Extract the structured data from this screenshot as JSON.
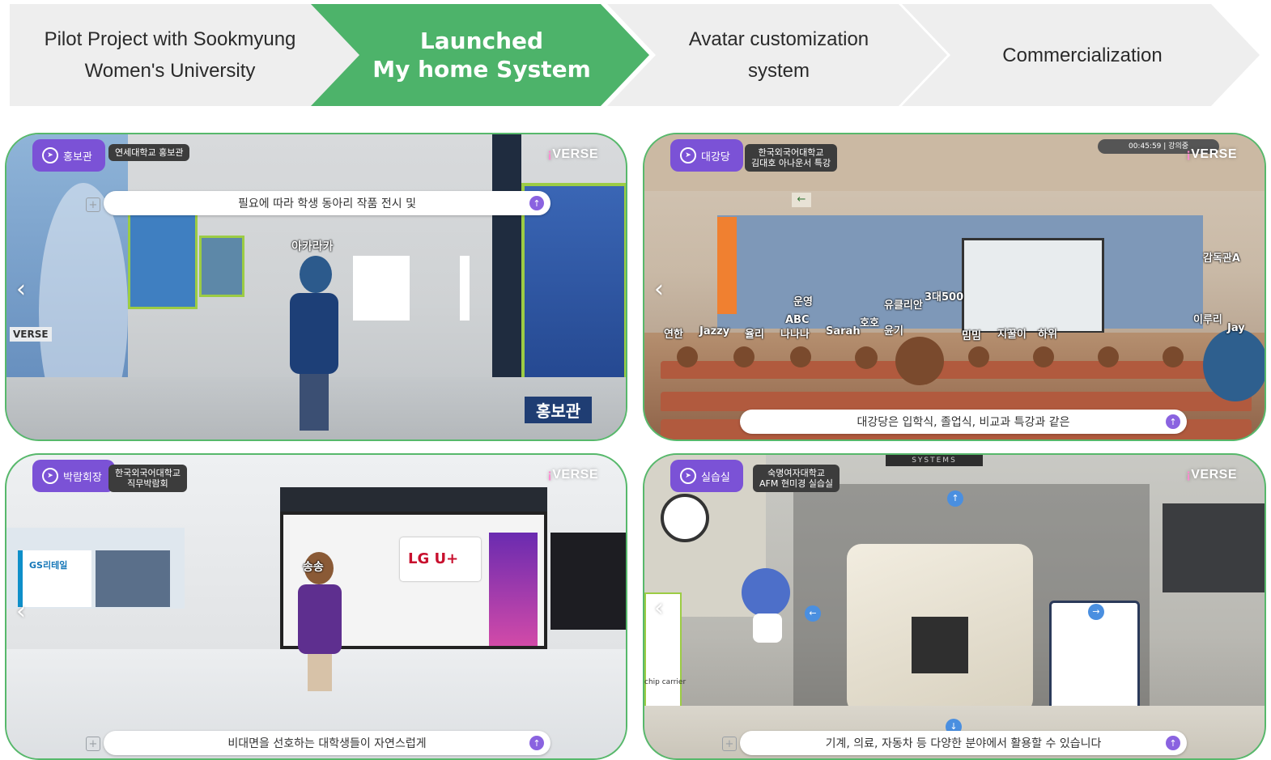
{
  "steps": [
    {
      "line1": "Pilot Project with Sookmyung",
      "line2": "Women's University",
      "active": false
    },
    {
      "line1": "Launched",
      "line2": "My home System",
      "active": true
    },
    {
      "line1": "Avatar customization",
      "line2": "system",
      "active": false
    },
    {
      "line1": "Commercialization",
      "line2": "",
      "active": false
    }
  ],
  "colors": {
    "accent_green": "#4db36a",
    "inactive_gray": "#eeeeee",
    "pill_purple": "#7b52d6",
    "panel_border": "#57b86b"
  },
  "brand": "VERSE",
  "panels": {
    "p1": {
      "location": "홍보관",
      "label": "연세대학교 홍보관",
      "chat": "필요에 따라 학생 동아리 작품 전시 및",
      "avatar_name": "아카라카",
      "sign": "홍보관",
      "wall_logo": "VERSE"
    },
    "p2": {
      "location": "대강당",
      "label_line1": "한국외국어대학교",
      "label_line2": "김대호 아나운서 특강",
      "chat": "대강당은 입학식, 졸업식, 비교과 특강과 같은",
      "timer": "00:45:59 | 강의중",
      "names": [
        "운영",
        "ABC",
        "나나나",
        "Sarah",
        "호호",
        "윤기",
        "유클리안",
        "3대500",
        "감독관A",
        "이루리",
        "Jay",
        "연한",
        "Jazzy",
        "율리",
        "밈밈",
        "지꿀이",
        "하위"
      ]
    },
    "p3": {
      "location": "박람회장",
      "label_line1": "한국외국어대학교",
      "label_line2": "직무박람회",
      "chat": "비대면을 선호하는 대학생들이 자연스럽게",
      "avatar_name": "송송",
      "booth1": "GS리테일",
      "booth2": "LG U+"
    },
    "p4": {
      "location": "실습실",
      "label_line1": "숙명여자대학교",
      "label_line2": "AFM 현미경 실습실",
      "chat": "기계, 의료, 자동차 등 다양한 분야에서 활용할 수 있습니다",
      "machine_brand": "SYSTEMS",
      "side_label": "chip carrier"
    }
  }
}
